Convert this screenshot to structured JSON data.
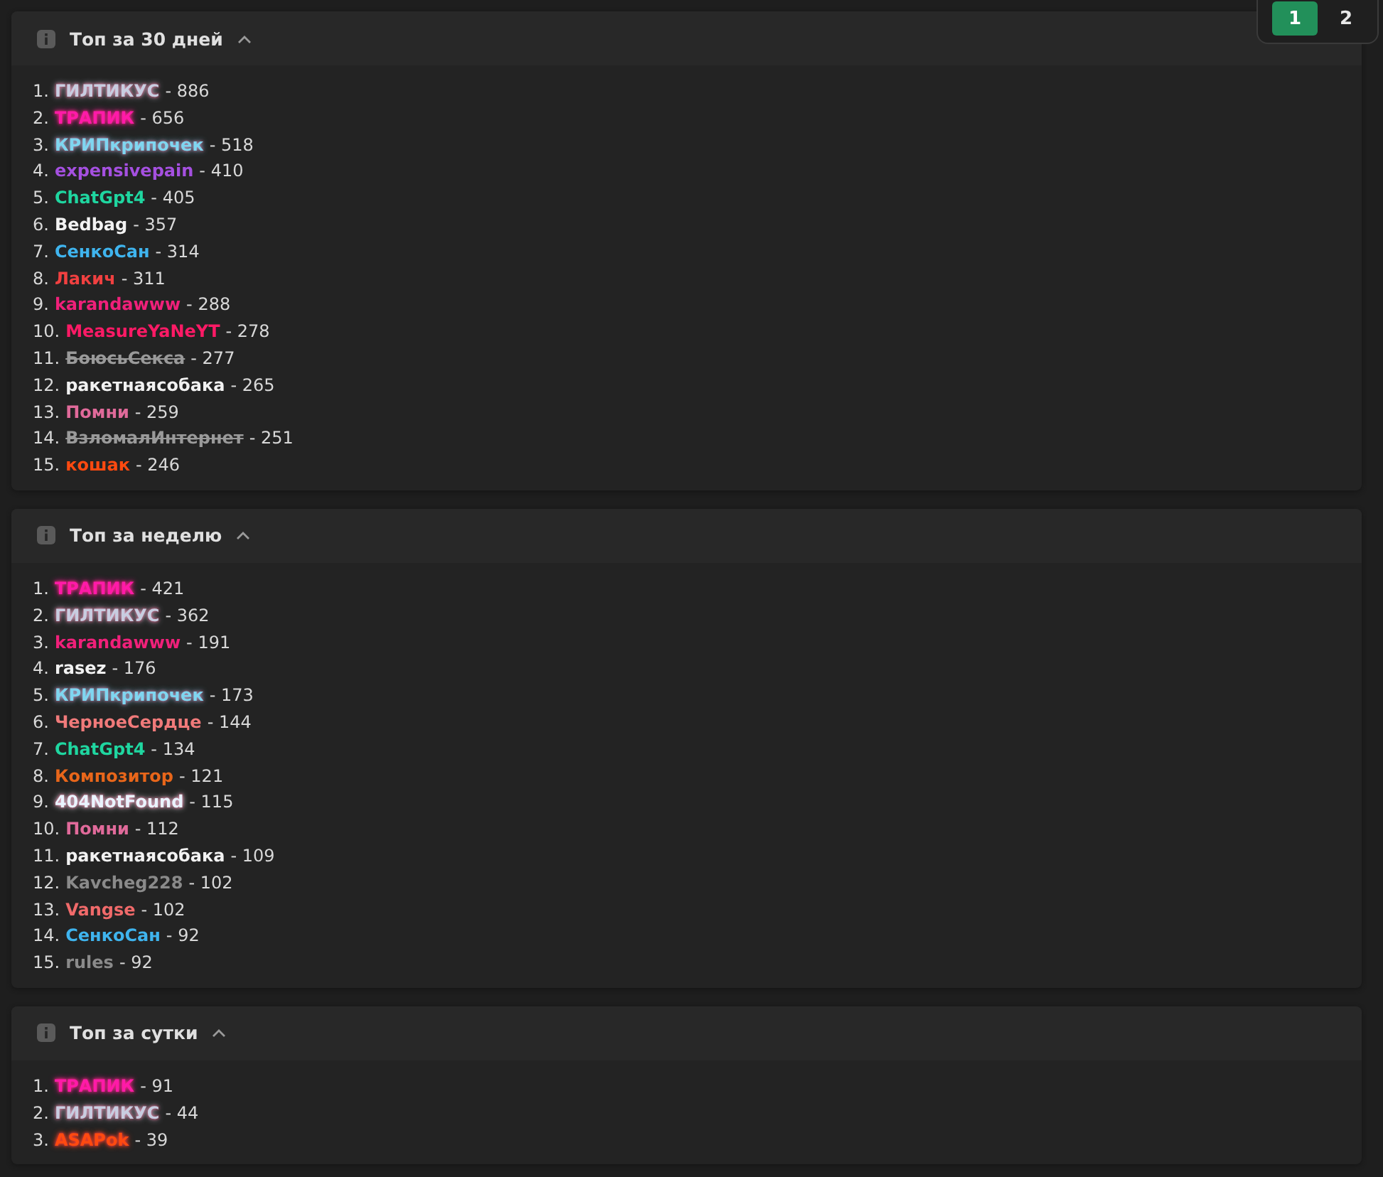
{
  "pagination": [
    {
      "label": "1",
      "selected": true
    },
    {
      "label": "2",
      "selected": false
    }
  ],
  "sections": [
    {
      "title": "Топ за 30 дней",
      "expanded": true,
      "entries": [
        {
          "rank": "1.",
          "name": "ГИЛТИКУС",
          "score": "- 886",
          "color": "#c8cde0",
          "kind": "glow"
        },
        {
          "rank": "2.",
          "name": "ТРАПИК",
          "score": "- 656",
          "color": "#ff1aa8",
          "kind": "glow"
        },
        {
          "rank": "3.",
          "name": "КРИПкрипочек",
          "score": "- 518",
          "color": "#7fd6f0",
          "kind": "glow"
        },
        {
          "rank": "4.",
          "name": "expensivepain",
          "score": "- 410",
          "color": "#a550e0",
          "kind": "plain"
        },
        {
          "rank": "5.",
          "name": "ChatGpt4",
          "score": "- 405",
          "color": "#1fd6a0",
          "kind": "plain"
        },
        {
          "rank": "6.",
          "name": "Bedbag",
          "score": "- 357",
          "color": "#f2f2f2",
          "kind": "plain"
        },
        {
          "rank": "7.",
          "name": "СенкоСан",
          "score": "- 314",
          "color": "#3fb4ee",
          "kind": "plain"
        },
        {
          "rank": "8.",
          "name": "Лакич",
          "score": "- 311",
          "color": "#f04040",
          "kind": "plain"
        },
        {
          "rank": "9.",
          "name": "karandawww",
          "score": "- 288",
          "color": "#f0207a",
          "kind": "plain"
        },
        {
          "rank": "10.",
          "name": "MeasureYaNeYT",
          "score": "- 278",
          "color": "#ff1a66",
          "kind": "plain"
        },
        {
          "rank": "11.",
          "name": "БоюсьСекса",
          "score": "- 277",
          "color": "#9a9a9a",
          "kind": "struck"
        },
        {
          "rank": "12.",
          "name": "ракетнаясобака",
          "score": "- 265",
          "color": "#f2f2f2",
          "kind": "plain"
        },
        {
          "rank": "13.",
          "name": "Помни",
          "score": "- 259",
          "color": "#e06a9a",
          "kind": "plain"
        },
        {
          "rank": "14.",
          "name": "ВзломалИнтернет",
          "score": "- 251",
          "color": "#9a9a9a",
          "kind": "struck"
        },
        {
          "rank": "15.",
          "name": "кошак",
          "score": "- 246",
          "color": "#ff4a10",
          "kind": "plain"
        }
      ]
    },
    {
      "title": "Топ за неделю",
      "expanded": true,
      "entries": [
        {
          "rank": "1.",
          "name": "ТРАПИК",
          "score": "- 421",
          "color": "#ff1aa8",
          "kind": "glow"
        },
        {
          "rank": "2.",
          "name": "ГИЛТИКУС",
          "score": "- 362",
          "color": "#c8cde0",
          "kind": "glow"
        },
        {
          "rank": "3.",
          "name": "karandawww",
          "score": "- 191",
          "color": "#f0207a",
          "kind": "plain"
        },
        {
          "rank": "4.",
          "name": "rasez",
          "score": "- 176",
          "color": "#f2f2f2",
          "kind": "plain"
        },
        {
          "rank": "5.",
          "name": "КРИПкрипочек",
          "score": "- 173",
          "color": "#7fd6f0",
          "kind": "glow"
        },
        {
          "rank": "6.",
          "name": "ЧерноеСердце",
          "score": "- 144",
          "color": "#f07a7a",
          "kind": "plain"
        },
        {
          "rank": "7.",
          "name": "ChatGpt4",
          "score": "- 134",
          "color": "#1fd6a0",
          "kind": "plain"
        },
        {
          "rank": "8.",
          "name": "Композитор",
          "score": "- 121",
          "color": "#e8661a",
          "kind": "plain"
        },
        {
          "rank": "9.",
          "name": "404NotFound",
          "score": "- 115",
          "color": "#eaf4ff",
          "kind": "glow"
        },
        {
          "rank": "10.",
          "name": "Помни",
          "score": "- 112",
          "color": "#e06a9a",
          "kind": "plain"
        },
        {
          "rank": "11.",
          "name": "ракетнаясобака",
          "score": "- 109",
          "color": "#f2f2f2",
          "kind": "plain"
        },
        {
          "rank": "12.",
          "name": "Kavcheg228",
          "score": "- 102",
          "color": "#8a8a8a",
          "kind": "plain"
        },
        {
          "rank": "13.",
          "name": "Vangse",
          "score": "- 102",
          "color": "#f06a6a",
          "kind": "plain"
        },
        {
          "rank": "14.",
          "name": "СенкоСан",
          "score": "- 92",
          "color": "#3fb4ee",
          "kind": "plain"
        },
        {
          "rank": "15.",
          "name": "rules",
          "score": "- 92",
          "color": "#8a8a8a",
          "kind": "plain"
        }
      ]
    },
    {
      "title": "Топ за сутки",
      "expanded": true,
      "entries": [
        {
          "rank": "1.",
          "name": "ТРАПИК",
          "score": "- 91",
          "color": "#ff1aa8",
          "kind": "glow"
        },
        {
          "rank": "2.",
          "name": "ГИЛТИКУС",
          "score": "- 44",
          "color": "#c8cde0",
          "kind": "glow"
        },
        {
          "rank": "3.",
          "name": "ASAPok",
          "score": "- 39",
          "color": "#ff4a10",
          "kind": "glow"
        }
      ]
    }
  ]
}
